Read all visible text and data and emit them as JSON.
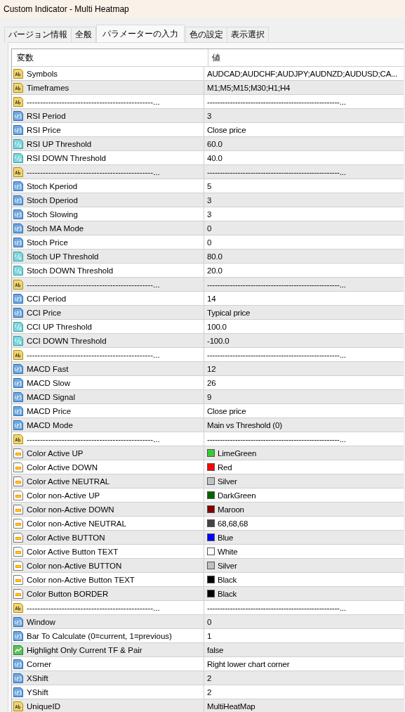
{
  "window": {
    "title": "Custom Indicator - Multi Heatmap"
  },
  "tabs": [
    {
      "label": "バージョン情報",
      "selected": false
    },
    {
      "label": "全般",
      "selected": false
    },
    {
      "label": "パラメーターの入力",
      "selected": true
    },
    {
      "label": "色の設定",
      "selected": false
    },
    {
      "label": "表示選択",
      "selected": false
    }
  ],
  "table": {
    "columns": [
      "変数",
      "値"
    ],
    "rows": [
      {
        "kind": "string",
        "name": "Symbols",
        "value": "AUDCAD;AUDCHF;AUDJPY;AUDNZD;AUDUSD;CA..."
      },
      {
        "kind": "string",
        "name": "Timeframes",
        "value": "M1;M5;M15;M30;H1;H4"
      },
      {
        "kind": "string",
        "name": "-----------------------------------------------...",
        "value": "----------------------------------------------------..."
      },
      {
        "kind": "int",
        "name": "RSI Period",
        "value": "3"
      },
      {
        "kind": "int",
        "name": "RSI Price",
        "value": "Close price"
      },
      {
        "kind": "double",
        "name": "RSI UP Threshold",
        "value": "60.0"
      },
      {
        "kind": "double",
        "name": "RSI DOWN Threshold",
        "value": "40.0"
      },
      {
        "kind": "string",
        "name": "-----------------------------------------------...",
        "value": "----------------------------------------------------..."
      },
      {
        "kind": "int",
        "name": "Stoch Kperiod",
        "value": "5"
      },
      {
        "kind": "int",
        "name": "Stoch Dperiod",
        "value": "3"
      },
      {
        "kind": "int",
        "name": "Stoch Slowing",
        "value": "3"
      },
      {
        "kind": "int",
        "name": "Stoch MA Mode",
        "value": "0"
      },
      {
        "kind": "int",
        "name": "Stoch Price",
        "value": "0"
      },
      {
        "kind": "double",
        "name": "Stoch UP Threshold",
        "value": "80.0"
      },
      {
        "kind": "double",
        "name": "Stoch DOWN Threshold",
        "value": "20.0"
      },
      {
        "kind": "string",
        "name": "-----------------------------------------------...",
        "value": "----------------------------------------------------..."
      },
      {
        "kind": "int",
        "name": "CCI Period",
        "value": "14"
      },
      {
        "kind": "int",
        "name": "CCI Price",
        "value": "Typical price"
      },
      {
        "kind": "double",
        "name": "CCI UP Threshold",
        "value": "100.0"
      },
      {
        "kind": "double",
        "name": "CCI DOWN Threshold",
        "value": "-100.0"
      },
      {
        "kind": "string",
        "name": "-----------------------------------------------...",
        "value": "----------------------------------------------------..."
      },
      {
        "kind": "int",
        "name": "MACD Fast",
        "value": "12"
      },
      {
        "kind": "int",
        "name": "MACD Slow",
        "value": "26"
      },
      {
        "kind": "int",
        "name": "MACD Signal",
        "value": "9"
      },
      {
        "kind": "int",
        "name": "MACD Price",
        "value": "Close price"
      },
      {
        "kind": "int",
        "name": "MACD Mode",
        "value": "Main vs Threshold (0)"
      },
      {
        "kind": "string",
        "name": "-----------------------------------------------...",
        "value": "----------------------------------------------------..."
      },
      {
        "kind": "color",
        "name": "Color Active UP",
        "value": "LimeGreen",
        "color": "#32cd32"
      },
      {
        "kind": "color",
        "name": "Color Active DOWN",
        "value": "Red",
        "color": "#ff0000"
      },
      {
        "kind": "color",
        "name": "Color Active NEUTRAL",
        "value": "Silver",
        "color": "#c0c0c0"
      },
      {
        "kind": "color",
        "name": "Color non-Active UP",
        "value": "DarkGreen",
        "color": "#006400"
      },
      {
        "kind": "color",
        "name": "Color non-Active DOWN",
        "value": "Maroon",
        "color": "#800000"
      },
      {
        "kind": "color",
        "name": "Color non-Active NEUTRAL",
        "value": "68,68,68",
        "color": "#444444"
      },
      {
        "kind": "color",
        "name": "Color Active BUTTON",
        "value": "Blue",
        "color": "#0000ff"
      },
      {
        "kind": "color",
        "name": "Color Active Button TEXT",
        "value": "White",
        "color": "#ffffff"
      },
      {
        "kind": "color",
        "name": "Color non-Active BUTTON",
        "value": "Silver",
        "color": "#c0c0c0"
      },
      {
        "kind": "color",
        "name": "Color non-Active Button TEXT",
        "value": "Black",
        "color": "#000000"
      },
      {
        "kind": "color",
        "name": "Color Button BORDER",
        "value": "Black",
        "color": "#000000"
      },
      {
        "kind": "string",
        "name": "-----------------------------------------------...",
        "value": "----------------------------------------------------..."
      },
      {
        "kind": "int",
        "name": "Window",
        "value": "0"
      },
      {
        "kind": "int",
        "name": "Bar To Calculate (0=current, 1=previous)",
        "value": "1"
      },
      {
        "kind": "bool",
        "name": "Highlight Only Current TF & Pair",
        "value": "false"
      },
      {
        "kind": "int",
        "name": "Corner",
        "value": "Right lower chart corner"
      },
      {
        "kind": "int",
        "name": "XShift",
        "value": "2"
      },
      {
        "kind": "int",
        "name": "YShift",
        "value": "2"
      },
      {
        "kind": "string",
        "name": "UniqueID",
        "value": "MultiHeatMap"
      }
    ]
  }
}
